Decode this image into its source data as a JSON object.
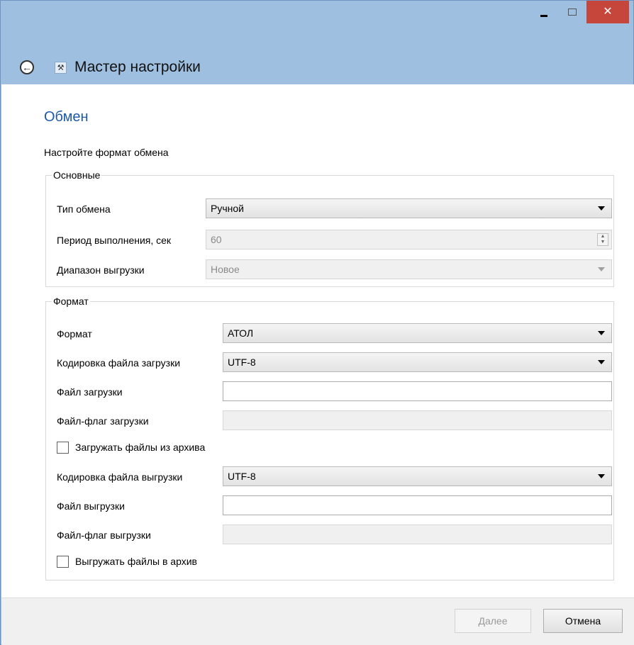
{
  "window": {
    "controls": {
      "minimize_icon": "minimize-icon",
      "maximize_icon": "maximize-icon",
      "close_glyph": "✕"
    }
  },
  "header": {
    "back_glyph": "←",
    "app_icon_glyph": "⚒",
    "title": "Мастер настройки"
  },
  "page": {
    "title": "Обмен",
    "instruction": "Настройте формат обмена"
  },
  "basic_group": {
    "legend": "Основные",
    "exchange_type": {
      "label": "Тип обмена",
      "value": "Ручной"
    },
    "period": {
      "label": "Период выполнения, сек",
      "value": "60"
    },
    "upload_range": {
      "label": "Диапазон выгрузки",
      "value": "Новое"
    }
  },
  "format_group": {
    "legend": "Формат",
    "format": {
      "label": "Формат",
      "value": "АТОЛ"
    },
    "load_encoding": {
      "label": "Кодировка файла загрузки",
      "value": "UTF-8"
    },
    "load_file": {
      "label": "Файл загрузки",
      "value": ""
    },
    "load_flag_file": {
      "label": "Файл-флаг загрузки",
      "value": ""
    },
    "load_from_archive": {
      "label": "Загружать файлы из архива",
      "checked": false
    },
    "upload_encoding": {
      "label": "Кодировка файла выгрузки",
      "value": "UTF-8"
    },
    "upload_file": {
      "label": "Файл выгрузки",
      "value": ""
    },
    "upload_flag_file": {
      "label": "Файл-флаг выгрузки",
      "value": ""
    },
    "upload_to_archive": {
      "label": "Выгружать файлы в архив",
      "checked": false
    }
  },
  "footer": {
    "next_label_underlined": "Д",
    "next_label_rest": "алее",
    "cancel_label": "Отмена"
  },
  "colors": {
    "window_frame": "#9ebfe0",
    "close_button": "#c7463c",
    "page_title": "#1e5aa8"
  }
}
